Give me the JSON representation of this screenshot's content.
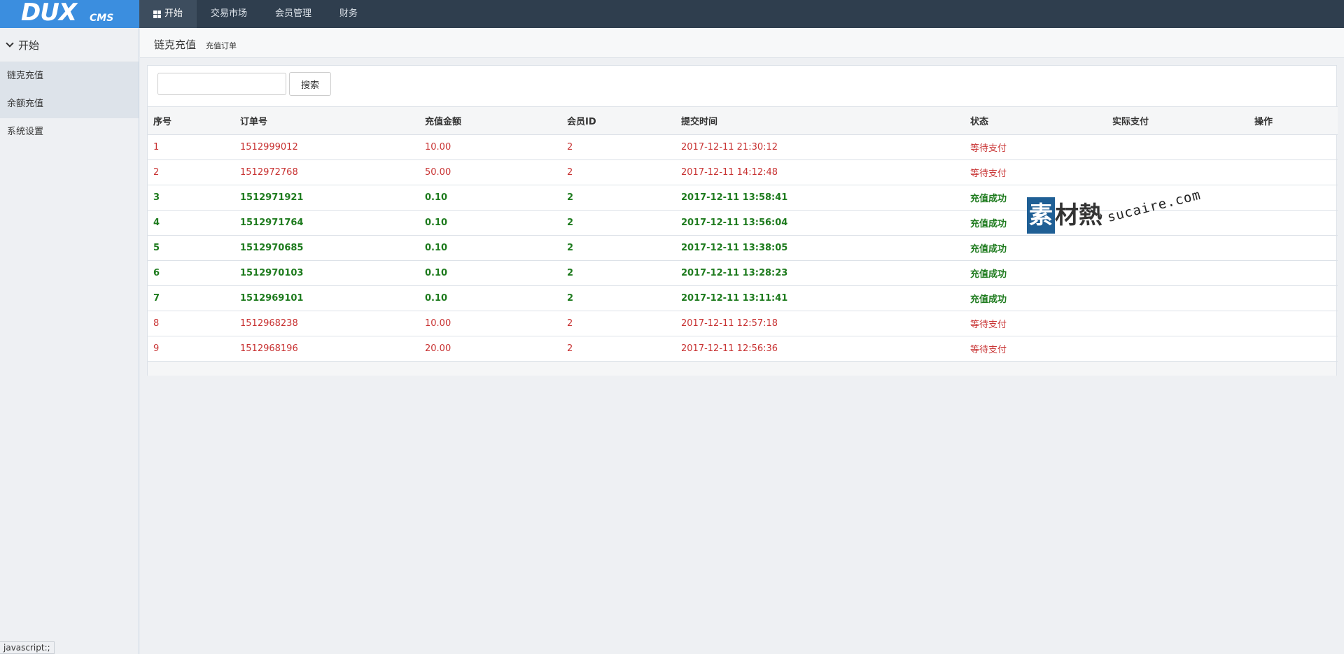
{
  "logo": {
    "main": "DUX",
    "sub": "CMS"
  },
  "topnav": [
    {
      "label": "开始",
      "active": true
    },
    {
      "label": "交易市场",
      "active": false
    },
    {
      "label": "会员管理",
      "active": false
    },
    {
      "label": "财务",
      "active": false
    }
  ],
  "sidebar": {
    "heading": "开始",
    "items": [
      {
        "label": "链克充值",
        "selected": true
      },
      {
        "label": "余额充值",
        "selected": true
      },
      {
        "label": "系统设置",
        "selected": false
      }
    ]
  },
  "breadcrumb": {
    "title": "链克充值",
    "sub": "充值订单"
  },
  "search": {
    "placeholder": "",
    "button": "搜索"
  },
  "table": {
    "columns": [
      "序号",
      "订单号",
      "充值金额",
      "会员ID",
      "提交时间",
      "状态",
      "实际支付",
      "操作"
    ],
    "rows": [
      {
        "status_type": "pending",
        "cells": [
          "1",
          "1512999012",
          "10.00",
          "2",
          "2017-12-11 21:30:12",
          "等待支付",
          "",
          ""
        ]
      },
      {
        "status_type": "pending",
        "cells": [
          "2",
          "1512972768",
          "50.00",
          "2",
          "2017-12-11 14:12:48",
          "等待支付",
          "",
          ""
        ]
      },
      {
        "status_type": "success",
        "cells": [
          "3",
          "1512971921",
          "0.10",
          "2",
          "2017-12-11 13:58:41",
          "充值成功",
          "",
          ""
        ]
      },
      {
        "status_type": "success",
        "cells": [
          "4",
          "1512971764",
          "0.10",
          "2",
          "2017-12-11 13:56:04",
          "充值成功",
          "",
          ""
        ]
      },
      {
        "status_type": "success",
        "cells": [
          "5",
          "1512970685",
          "0.10",
          "2",
          "2017-12-11 13:38:05",
          "充值成功",
          "",
          ""
        ]
      },
      {
        "status_type": "success",
        "cells": [
          "6",
          "1512970103",
          "0.10",
          "2",
          "2017-12-11 13:28:23",
          "充值成功",
          "",
          ""
        ]
      },
      {
        "status_type": "success",
        "cells": [
          "7",
          "1512969101",
          "0.10",
          "2",
          "2017-12-11 13:11:41",
          "充值成功",
          "",
          ""
        ]
      },
      {
        "status_type": "pending",
        "cells": [
          "8",
          "1512968238",
          "10.00",
          "2",
          "2017-12-11 12:57:18",
          "等待支付",
          "",
          ""
        ]
      },
      {
        "status_type": "pending",
        "cells": [
          "9",
          "1512968196",
          "20.00",
          "2",
          "2017-12-11 12:56:36",
          "等待支付",
          "",
          ""
        ]
      }
    ]
  },
  "watermark": {
    "glyph": "素",
    "rest": "材熱",
    "url": "sucaire.com"
  },
  "statusbar": "javascript:;",
  "colors": {
    "topbar": "#2f3e4e",
    "logo_bg": "#3b8edf",
    "pending": "#c83232",
    "success": "#1e7b1e"
  }
}
